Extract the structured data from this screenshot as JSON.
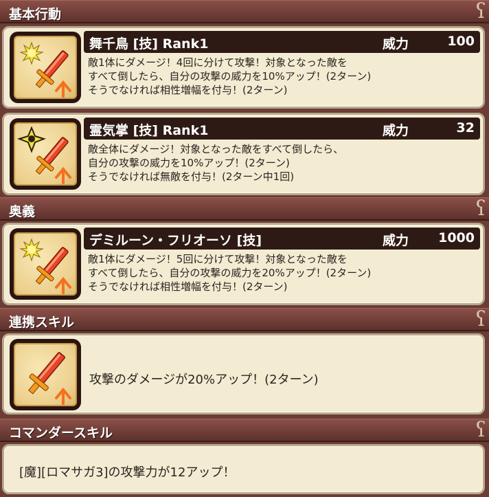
{
  "sections": {
    "basic": "基本行動",
    "ougi": "奥義",
    "link": "連携スキル",
    "commander": "コマンダースキル"
  },
  "scroll_glyph": "ʕ",
  "power_label": "威力",
  "skills": [
    {
      "name": "舞千鳥 [技]  Rank1",
      "power": "100",
      "icon": "burst-sword-icon",
      "desc": [
        "敵1体にダメージ！4回に分けて攻撃！対象となった敵を",
        "すべて倒したら、自分の攻撃の威力を10%アップ！(2ターン)",
        "そうでなければ相性増幅を付与！(2ターン)"
      ]
    },
    {
      "name": "霊気掌 [技]  Rank1",
      "power": "32",
      "icon": "shuriken-sword-icon",
      "desc": [
        "敵全体にダメージ！対象となった敵をすべて倒したら、",
        "自分の攻撃の威力を10%アップ！(2ターン)",
        "そうでなければ無敵を付与！(2ターン中1回)"
      ]
    },
    {
      "name": "デミルーン・フリオーソ [技]",
      "power": "1000",
      "icon": "burst-sword-icon",
      "desc": [
        "敵1体にダメージ！5回に分けて攻撃！対象となった敵を",
        "すべて倒したら、自分の攻撃の威力を20%アップ！(2ターン)",
        "そうでなければ相性増幅を付与！(2ターン)"
      ]
    }
  ],
  "link_skill": {
    "text": "攻撃のダメージが20%アップ！(2ターン)",
    "icon": "sword-up-icon"
  },
  "commander_skill": {
    "text": "[魔][ロマサガ3]の攻撃力が12アップ！"
  },
  "colors": {
    "header": "#74403a",
    "card": "#f3ecd3",
    "skill_bar": "#2e1a14",
    "sword": "#e8452a",
    "burst": "#f4e23a"
  }
}
